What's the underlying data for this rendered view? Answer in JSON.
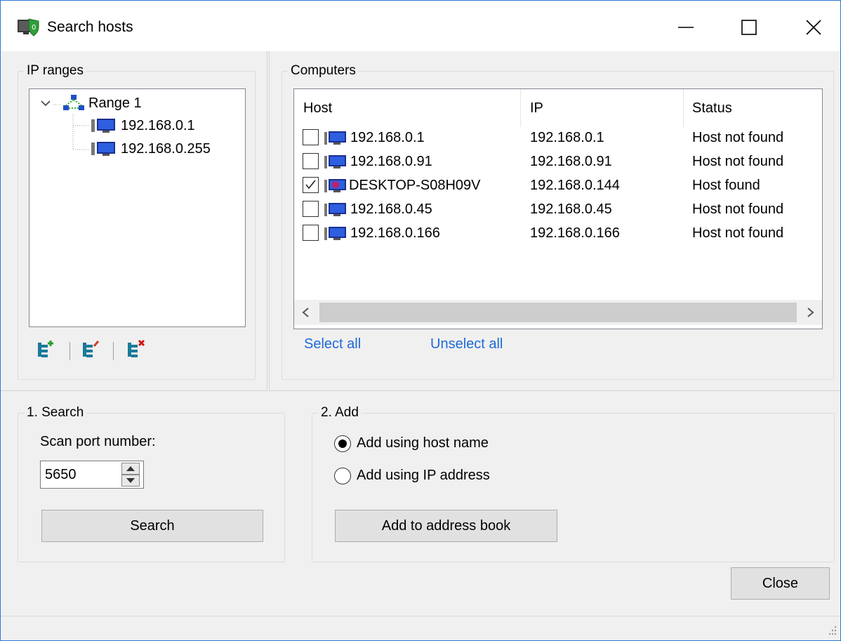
{
  "window": {
    "title": "Search hosts",
    "icon": "shield-monitor-icon"
  },
  "ip_ranges": {
    "legend": "IP ranges",
    "tree": {
      "range_label": "Range 1",
      "children": [
        "192.168.0.1",
        "192.168.0.255"
      ]
    },
    "tools": [
      "add-range-icon",
      "edit-range-icon",
      "delete-range-icon"
    ]
  },
  "computers": {
    "legend": "Computers",
    "columns": [
      "Host",
      "IP",
      "Status"
    ],
    "rows": [
      {
        "host": "192.168.0.1",
        "ip": "192.168.0.1",
        "status": "Host not found",
        "checked": false
      },
      {
        "host": "192.168.0.91",
        "ip": "192.168.0.91",
        "status": "Host not found",
        "checked": false
      },
      {
        "host": "DESKTOP-S08H09V",
        "ip": "192.168.0.144",
        "status": "Host found",
        "checked": true
      },
      {
        "host": "192.168.0.45",
        "ip": "192.168.0.45",
        "status": "Host not found",
        "checked": false
      },
      {
        "host": "192.168.0.166",
        "ip": "192.168.0.166",
        "status": "Host not found",
        "checked": false
      }
    ],
    "select_all": "Select all",
    "unselect_all": "Unselect all"
  },
  "search": {
    "legend": "1. Search",
    "port_label": "Scan port number:",
    "port_value": "5650",
    "button": "Search"
  },
  "add": {
    "legend": "2. Add",
    "option_hostname": "Add using host name",
    "option_ip": "Add using IP address",
    "selected": "hostname",
    "button": "Add to address book"
  },
  "close_button": "Close",
  "colors": {
    "accent": "#2b7bd1",
    "link": "#1e6ad6",
    "found_icon": "#c0206a"
  }
}
